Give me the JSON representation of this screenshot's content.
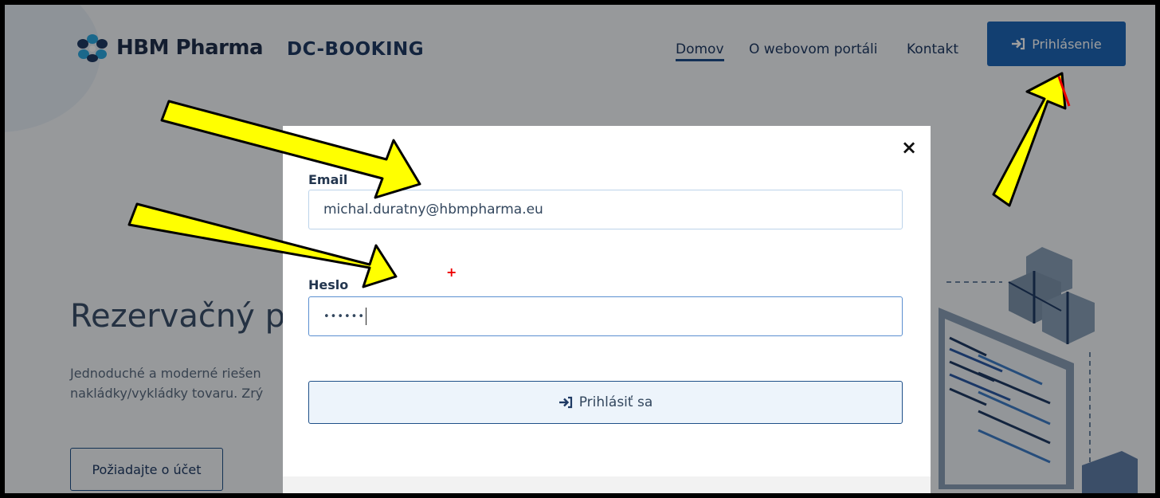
{
  "header": {
    "logo_text": "HBM Pharma",
    "brand": "DC-BOOKING",
    "nav": [
      {
        "label": "Domov",
        "active": true
      },
      {
        "label": "O webovom portáli"
      },
      {
        "label": "Kontakt"
      }
    ],
    "login_label": "Prihlásenie"
  },
  "hero": {
    "title": "Rezervačný por",
    "desc_line1": "Jednoduché a moderné riešen",
    "desc_line2": "nakládky/vykládky tovaru. Zrý",
    "button_label": "Požiadajte o účet"
  },
  "modal": {
    "close_glyph": "×",
    "email_label": "Email",
    "email_value": "michal.duratny@hbmpharma.eu",
    "password_label": "Heslo",
    "password_value": "••••••",
    "submit_label": "Prihlásiť sa"
  },
  "annotation": {
    "marker_glyph": "+",
    "arrow_color": "#ffff00"
  },
  "colors": {
    "primary": "#1e67b7",
    "navy": "#1f3a64"
  }
}
